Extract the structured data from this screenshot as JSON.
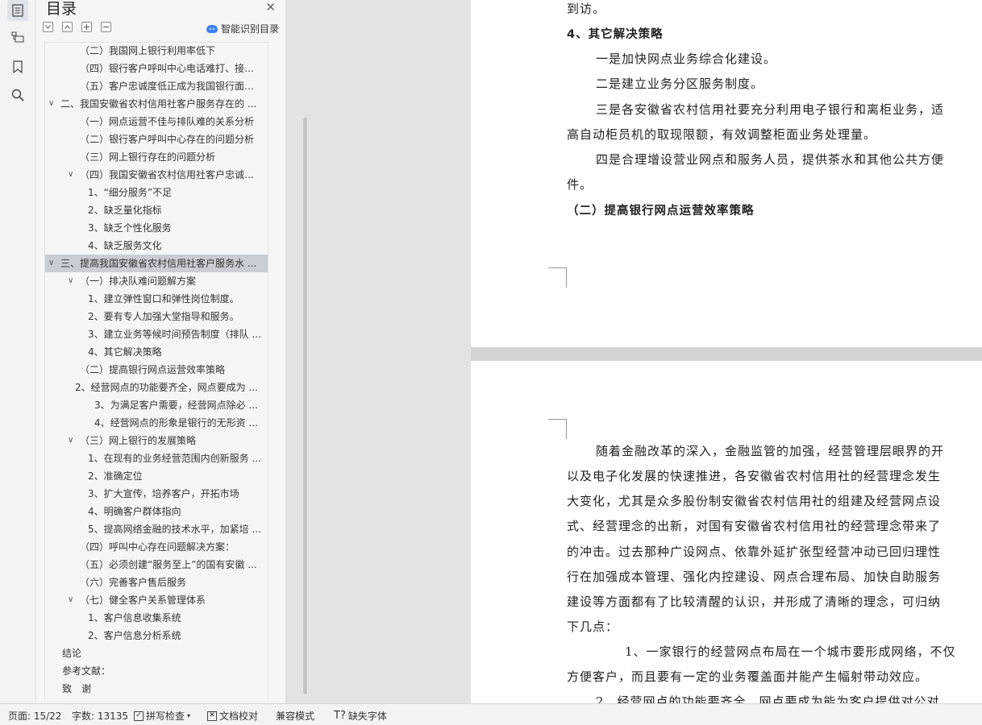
{
  "sidebar": {
    "title": "目录",
    "ai_label": "智能识别目录",
    "items": [
      {
        "text": "（二）我国网上银行利用率低下"
      },
      {
        "text": "（四）银行客户呼叫中心电话难打、接通 ..."
      },
      {
        "text": "（五）客户忠诚度低正成为我国银行面临 ..."
      },
      {
        "text": "二、我国安徽省农村信用社客户服务存在的 ..."
      },
      {
        "text": "（一）网点运营不佳与排队难的关系分析"
      },
      {
        "text": "（二）银行客户呼叫中心存在的问题分析"
      },
      {
        "text": "（三）网上银行存在的问题分析"
      },
      {
        "text": "（四）我国安徽省农村信用社客户忠诚度 ..."
      },
      {
        "text": "1、“细分服务”不足"
      },
      {
        "text": "2、缺乏量化指标"
      },
      {
        "text": "3、缺乏个性化服务"
      },
      {
        "text": "4、缺乏服务文化"
      },
      {
        "text": "三、提高我国安徽省农村信用社客户服务水 ..."
      },
      {
        "text": "（一）排决队难问题解方案"
      },
      {
        "text": "1、建立弹性窗口和弹性岗位制度。"
      },
      {
        "text": "2、要有专人加强大堂指导和服务。"
      },
      {
        "text": "3、建立业务等候时间预告制度（排队 ..."
      },
      {
        "text": "4、其它解决策略"
      },
      {
        "text": "（二）提高银行网点运营效率策略"
      },
      {
        "text": "2、经营网点的功能要齐全，网点要成为 ..."
      },
      {
        "text": "3、为满足客户需要，经营网点除必 ..."
      },
      {
        "text": "4、经营网点的形象是银行的无形资 ..."
      },
      {
        "text": "（三）网上银行的发展策略"
      },
      {
        "text": "1、在现有的业务经营范围内创新服务 ..."
      },
      {
        "text": "2、准确定位"
      },
      {
        "text": "3、扩大宣传，培养客户，开拓市场"
      },
      {
        "text": "4、明确客户群体指向"
      },
      {
        "text": "5、提高网络金融的技术水平，加紧培 ..."
      },
      {
        "text": "（四）呼叫中心存在问题解决方案："
      },
      {
        "text": "（五）必须创建“服务至上”的国有安徽 ..."
      },
      {
        "text": "（六）完善客户售后服务"
      },
      {
        "text": "（七）健全客户关系管理体系"
      },
      {
        "text": "1、客户信息收集系统"
      },
      {
        "text": "2、客户信息分析系统"
      },
      {
        "text": "结论"
      },
      {
        "text": "参考文献："
      },
      {
        "text": "致　谢"
      }
    ]
  },
  "document": {
    "page1_lines": [
      "到访。",
      "4、其它解决策略",
      "一是加快网点业务综合化建设。",
      "二是建立业务分区服务制度。",
      "三是各安徽省农村信用社要充分利用电子银行和离柜业务，适",
      "高自动柜员机的取现限额，有效调整柜面业务处理量。",
      "四是合理增设营业网点和服务人员，提供茶水和其他公共方便",
      "件。",
      "（二）提高银行网点运营效率策略"
    ],
    "page2_lines": [
      "随着金融改革的深入，金融监管的加强，经营管理层眼界的开",
      "以及电子化发展的快速推进，各安徽省农村信用社的经营理念发生",
      "大变化，尤其是众多股份制安徽省农村信用社的组建及经营网点设",
      "式、经营理念的出新，对国有安徽省农村信用社的经营理念带来了",
      "的冲击。过去那种广设网点、依靠外延扩张型经营冲动已回归理性",
      "行在加强成本管理、强化内控建设、网点合理布局、加快自助服务",
      "建设等方面都有了比较清醒的认识，并形成了清晰的理念，可归纳",
      "下几点：",
      "1、一家银行的经营网点布局在一个城市要形成网络，不仅",
      "方便客户，而且要有一定的业务覆盖面并能产生幅射带动效应。",
      "2、经营网点的功能要齐全，网点要成为能为客户提供对公对"
    ]
  },
  "statusbar": {
    "page": "页面: 15/22",
    "words": "字数: 13135",
    "spellcheck": "拼写检查",
    "proofread": "文档校对",
    "compat": "兼容模式",
    "missing_font": "缺失字体"
  }
}
